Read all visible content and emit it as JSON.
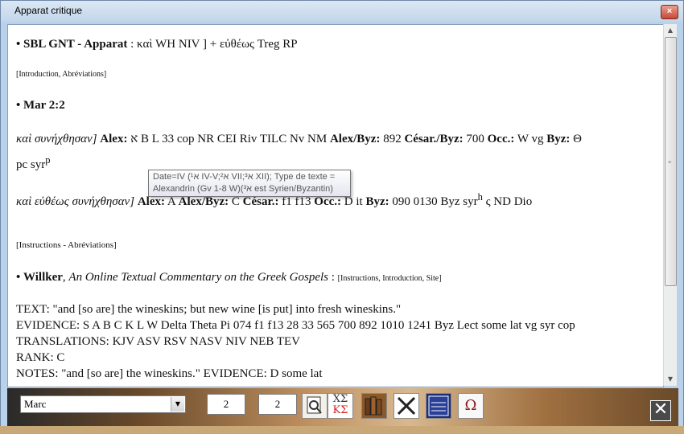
{
  "window": {
    "title": "Apparat critique",
    "close_glyph": "×"
  },
  "sbl": {
    "bullet": "•",
    "label": "SBL GNT - Apparat",
    "colon": " : ",
    "text": "καὶ WH NIV ] + εὐθέως Treg RP",
    "links": "[Introduction, Abréviations]"
  },
  "verse": {
    "bullet": "•",
    "label": "Mar 2:2"
  },
  "line1": {
    "greek": "καὶ συνήχθησαν]",
    "alex_label": "Alex:",
    "alex_text": "א B L 33 cop NR CEI Riv TILC Nv NM",
    "alexbyz_label": "Alex/Byz:",
    "alexbyz_text": "892",
    "cesbyz_label": "César./Byz:",
    "cesbyz_text": "700",
    "occ_label": "Occ.:",
    "occ_text": "W vg",
    "byz_label": "Byz:",
    "byz_text": "Θ",
    "cont": "pc syr",
    "sup": "p"
  },
  "tooltip": {
    "line1": "Date=IV (א¹ IV-V;א² VII;א³ XII); Type de texte =",
    "line2": "Alexandrin (Gv 1-8 W)(א³ est Syrien/Byzantin)"
  },
  "line2": {
    "greek": "καὶ εὐθέως συνήχθησαν]",
    "alex_label": "Alex:",
    "alex_text": "A",
    "alexbyz_label": "Alex/Byz:",
    "alexbyz_text": "C",
    "ces_label": "César.:",
    "ces_text": "f1 f13",
    "occ_label": "Occ.:",
    "occ_text": "D it",
    "byz_label": "Byz:",
    "byz_text": "090 0130 Byz syr",
    "sup": "h",
    "tail": " ς ND Dio"
  },
  "instructions": "[Instructions - Abréviations]",
  "willker": {
    "bullet": "•",
    "name": "Willker",
    "sep": ", ",
    "title": "An Online Textual Commentary on the Greek Gospels",
    "colon": " : ",
    "links": "[Instructions, Introduction, Site]"
  },
  "commentary": [
    "TEXT: \"and [so are] the wineskins; but new wine [is put] into fresh wineskins.\"",
    "EVIDENCE: S A B C K L W Delta Theta Pi 074 f1 f13 28 33 565 700 892 1010 1241 Byz Lect some lat vg syr cop",
    "TRANSLATIONS: KJV ASV RSV NASV NIV NEB TEV",
    "RANK: C",
    "NOTES: \"and [so are] the wineskins.\" EVIDENCE: D some lat"
  ],
  "toolbar": {
    "book": "Marc",
    "chapter": "2",
    "verse": "2",
    "greek_glyph": "XΣ",
    "greek_glyph2": "ΚΣ",
    "omega": "Ω",
    "close": "✕"
  },
  "colors": {
    "accent": "#c8483a",
    "link_red": "#d02020"
  }
}
